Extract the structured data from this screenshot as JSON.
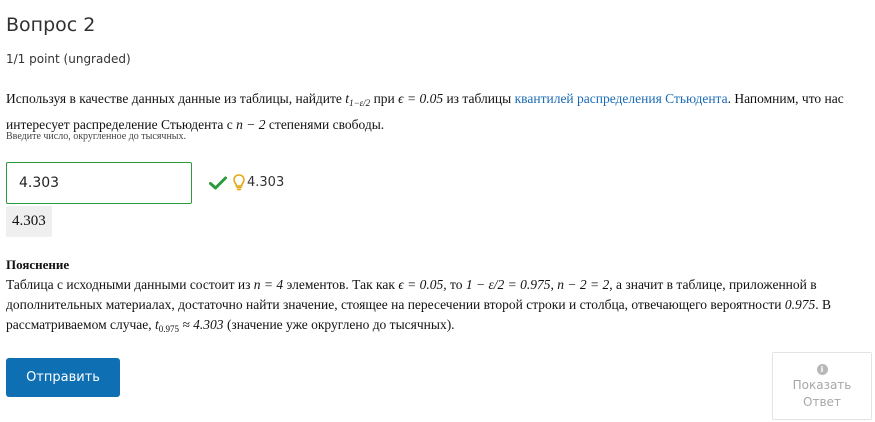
{
  "question": {
    "title": "Вопрос 2",
    "points": "1/1 point (ungraded)",
    "text": {
      "p1": "Используя в качестве данных данные из таблицы, найдите ",
      "t_var": "t",
      "t_sub": "1−ε/2",
      "p2": " при ",
      "formula_eps": "ϵ = 0.05",
      "p3": " из таблицы ",
      "link": "квантилей распределения Стьюдента",
      "p4": ". Напомним, что нас интересует распределение Стьюдента с ",
      "formula_df": "n − 2",
      "p5": " степенями свободы."
    },
    "hint": "Введите число, округленное до тысячных."
  },
  "answer": {
    "value": "4.303",
    "status_value": "4.303",
    "preview": "4.303"
  },
  "explanation": {
    "heading": "Пояснение",
    "s1": "Таблица с исходными данными состоит из ",
    "f1": "n = 4",
    "s2": " элементов. Так как ",
    "f2": "ϵ = 0.05",
    "s3": ", то ",
    "f3": "1 − ε/2 = 0.975",
    "s4": ", ",
    "f4": "n − 2 = 2",
    "s5": ", а значит в таблице, приложенной в дополнительных материалах, достаточно найти значение, стоящее на пересечении второй строки и столбца, отвечающего вероятности ",
    "f5": "0.975",
    "s6": ". В рассматриваемом случае, ",
    "t_var": "t",
    "t_sub": "0.975",
    "f6": " ≈ 4.303",
    "s7": " (значение уже округлено до тысячных)."
  },
  "buttons": {
    "submit": "Отправить",
    "show_answer_line1": "Показать",
    "show_answer_line2": "Ответ"
  },
  "icons": {
    "correct": "checkmark-icon",
    "hint": "lightbulb-icon",
    "info": "info-icon"
  },
  "colors": {
    "correct_green": "#2b9a3a",
    "submit_blue": "#0e6fb3",
    "link_blue": "#1a6bb5",
    "hint_yellow": "#e5a70f"
  }
}
